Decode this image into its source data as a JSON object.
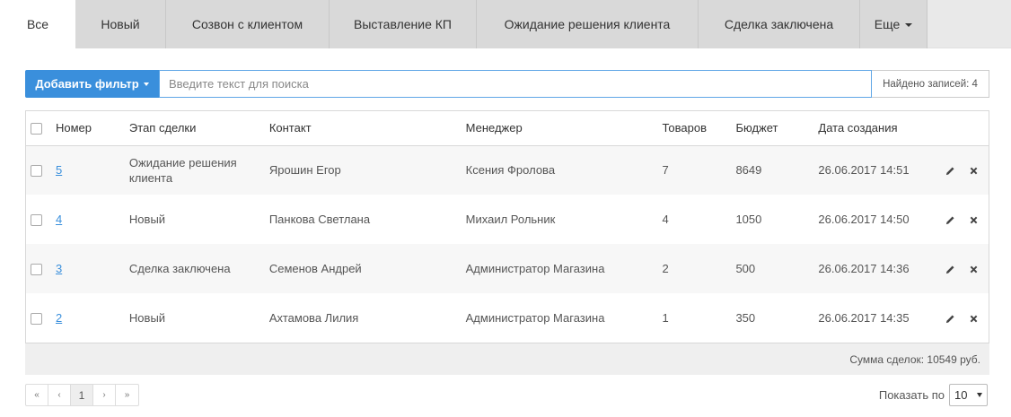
{
  "tabs": [
    {
      "label": "Все"
    },
    {
      "label": "Новый"
    },
    {
      "label": "Созвон с клиентом"
    },
    {
      "label": "Выставление КП"
    },
    {
      "label": "Ожидание решения клиента"
    },
    {
      "label": "Сделка заключена"
    },
    {
      "label": "Еще"
    }
  ],
  "active_tab": "Все",
  "toolbar": {
    "add_filter_label": "Добавить фильтр",
    "search_placeholder": "Введите текст для поиска",
    "search_value": "",
    "found_label": "Найдено записей: 4"
  },
  "table": {
    "columns": [
      "Номер",
      "Этап сделки",
      "Контакт",
      "Менеджер",
      "Товаров",
      "Бюджет",
      "Дата создания"
    ],
    "rows": [
      {
        "number": "5",
        "stage": "Ожидание решения клиента",
        "contact": "Ярошин Егор",
        "manager": "Ксения Фролова",
        "items": "7",
        "budget": "8649",
        "created": "26.06.2017 14:51"
      },
      {
        "number": "4",
        "stage": "Новый",
        "contact": "Панкова Светлана",
        "manager": "Михаил Рольник",
        "items": "4",
        "budget": "1050",
        "created": "26.06.2017 14:50"
      },
      {
        "number": "3",
        "stage": "Сделка заключена",
        "contact": "Семенов Андрей",
        "manager": "Администратор Магазина",
        "items": "2",
        "budget": "500",
        "created": "26.06.2017 14:36"
      },
      {
        "number": "2",
        "stage": "Новый",
        "contact": "Ахтамова Лилия",
        "manager": "Администратор Магазина",
        "items": "1",
        "budget": "350",
        "created": "26.06.2017 14:35"
      }
    ]
  },
  "summary": {
    "total_label": "Сумма сделок: 10549 руб."
  },
  "pagination": {
    "first": "«",
    "prev": "‹",
    "current": "1",
    "next": "›",
    "last": "»"
  },
  "page_size": {
    "label": "Показать по",
    "value": "10"
  },
  "colors": {
    "accent": "#3a8fdc",
    "tab_bg": "#d9d9d9",
    "row_stripe": "#f7f7f7"
  }
}
